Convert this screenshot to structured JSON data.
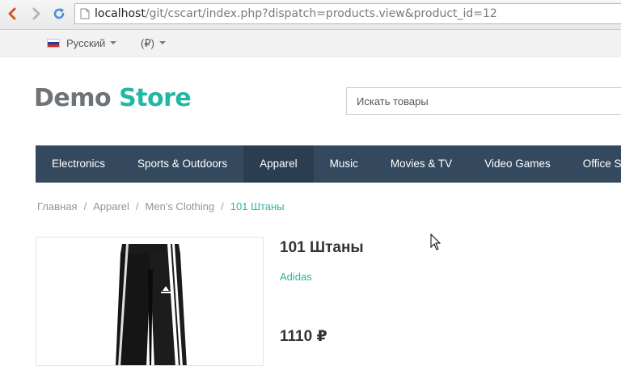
{
  "browser": {
    "url_host": "localhost",
    "url_path": "/git/cscart/index.php?dispatch=products.view&product_id=12"
  },
  "topbar": {
    "language": "Русский",
    "currency": "(₽)"
  },
  "logo": {
    "part1": "Demo",
    "part2": "Store"
  },
  "search": {
    "placeholder": "Искать товары"
  },
  "menu": {
    "items": [
      {
        "label": "Electronics"
      },
      {
        "label": "Sports & Outdoors"
      },
      {
        "label": "Apparel"
      },
      {
        "label": "Music"
      },
      {
        "label": "Movies & TV"
      },
      {
        "label": "Video Games"
      },
      {
        "label": "Office Sup"
      }
    ]
  },
  "breadcrumb": {
    "items": [
      "Главная",
      "Apparel",
      "Men's Clothing"
    ],
    "current": "101 Штаны",
    "separator": "/"
  },
  "product": {
    "title": "101 Штаны",
    "brand": "Adidas",
    "price": "1110 ₽"
  },
  "colors": {
    "accent": "#21b8a3",
    "menu_bg": "#34495e",
    "menu_active": "#2b3d50"
  }
}
